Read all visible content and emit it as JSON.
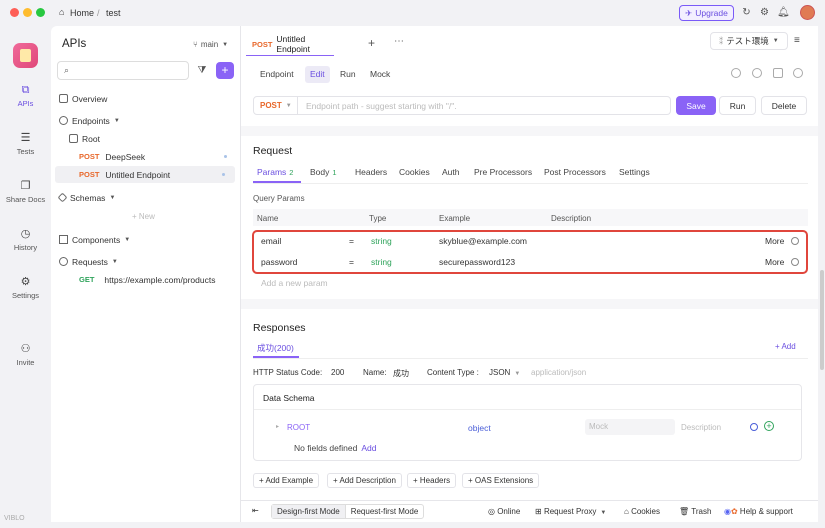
{
  "titlebar": {
    "home_label": "Home",
    "separator": "/",
    "project": "test",
    "upgrade_label": "Upgrade"
  },
  "rail": {
    "items": [
      {
        "label": "APIs",
        "icon": "api-icon"
      },
      {
        "label": "Tests",
        "icon": "tests-icon"
      },
      {
        "label": "Share Docs",
        "icon": "book-icon"
      },
      {
        "label": "History",
        "icon": "clock-icon"
      },
      {
        "label": "Settings",
        "icon": "gear-icon"
      },
      {
        "label": "Invite",
        "icon": "add-user-icon"
      }
    ],
    "bottom_brand": "VIBLO"
  },
  "sidebar": {
    "title": "APIs",
    "branch": "main",
    "search_placeholder": "",
    "overview": "Overview",
    "endpoints": "Endpoints",
    "root": "Root",
    "items": [
      {
        "method": "POST",
        "name": "DeepSeek"
      },
      {
        "method": "POST",
        "name": "Untitled Endpoint"
      }
    ],
    "schemas": "Schemas",
    "new_label": "+ New",
    "components": "Components",
    "requests": "Requests",
    "request_items": [
      {
        "method": "GET",
        "name": "https://example.com/products"
      }
    ]
  },
  "main": {
    "tab_method": "POST",
    "tab_title": "Untitled Endpoint",
    "env": "テスト環境",
    "subtabs": [
      "Endpoint",
      "Edit",
      "Run",
      "Mock"
    ],
    "method": "POST",
    "path_placeholder": "Endpoint path - suggest starting with \"/\".",
    "save": "Save",
    "run": "Run",
    "delete": "Delete",
    "request_heading": "Request",
    "param_tabs": [
      {
        "label": "Params",
        "count": "2"
      },
      {
        "label": "Body",
        "count": "1"
      },
      {
        "label": "Headers",
        "count": ""
      },
      {
        "label": "Cookies",
        "count": ""
      },
      {
        "label": "Auth",
        "count": ""
      },
      {
        "label": "Pre Processors",
        "count": ""
      },
      {
        "label": "Post Processors",
        "count": ""
      },
      {
        "label": "Settings",
        "count": ""
      }
    ],
    "query_params_label": "Query Params",
    "columns": [
      "Name",
      "Type",
      "Example",
      "Description"
    ],
    "params": [
      {
        "name": "email",
        "eq": "=",
        "type": "string",
        "example": "skyblue@example.com",
        "more": "More"
      },
      {
        "name": "password",
        "eq": "=",
        "type": "string",
        "example": "securepassword123",
        "more": "More"
      }
    ],
    "add_param": "Add a new param",
    "responses_heading": "Responses",
    "response_tab": "成功(200)",
    "response_add": "+ Add",
    "http_status_label": "HTTP Status Code:",
    "http_status_value": "200",
    "name_label": "Name:",
    "name_value": "成功",
    "content_type_label": "Content Type :",
    "content_type_value": "JSON",
    "content_type_hint": "application/json",
    "data_schema": "Data Schema",
    "root_label": "ROOT",
    "root_type": "object",
    "mock_placeholder": "Mock",
    "desc_placeholder": "Description",
    "no_fields": "No fields defined",
    "add_link": "Add",
    "chips": [
      "+ Add Example",
      "+ Add Description",
      "+ Headers",
      "+ OAS Extensions"
    ]
  },
  "statusbar": {
    "design_mode": "Design-first Mode",
    "request_mode": "Request-first Mode",
    "online": "Online",
    "proxy": "Request Proxy",
    "cookies": "Cookies",
    "trash": "Trash",
    "help": "Help & support"
  },
  "colors": {
    "accent": "#8a63f6",
    "post": "#e8672a",
    "get": "#2fa35b",
    "highlight": "#e0463c"
  }
}
